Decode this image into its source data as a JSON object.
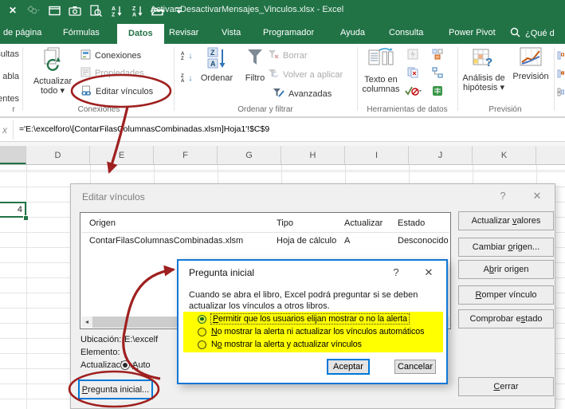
{
  "colors": {
    "excel_green": "#217346",
    "highlight_yellow": "#ffff00",
    "annotation_red": "#9f2020",
    "accent_blue": "#0078d7"
  },
  "titlebar": {
    "title": "Activar-DesactivarMensajes_Vinculos.xlsx - Excel",
    "qat_icons": [
      "close-icon",
      "shapes-icon",
      "new-window-icon",
      "camera-icon",
      "print-preview-icon",
      "sort-asc-icon",
      "sort-desc-icon",
      "open-folder-icon",
      "customize-qat-icon"
    ]
  },
  "tabs": {
    "items": [
      {
        "label": "de página"
      },
      {
        "label": "Fórmulas"
      },
      {
        "label": "Datos"
      },
      {
        "label": "Revisar"
      },
      {
        "label": "Vista"
      },
      {
        "label": "Programador"
      },
      {
        "label": "Ayuda"
      },
      {
        "label": "Consulta"
      },
      {
        "label": "Power Pivot"
      }
    ],
    "active": "Datos",
    "search_hint": "¿Qué d"
  },
  "ribbon": {
    "clipped_left": [
      "sultas",
      "abla",
      "entes"
    ],
    "clipped_group_label": "r",
    "refresh_all": {
      "line1": "Actualizar",
      "line2": "todo ▾"
    },
    "connections_group": {
      "conexiones": "Conexiones",
      "propiedades": "Propiedades",
      "editar_vinculos": "Editar vínculos",
      "label": "Conexiones"
    },
    "sort_group": {
      "ordenar": "Ordenar",
      "filtro": "Filtro",
      "borrar": "Borrar",
      "volver": "Volver a aplicar",
      "avanzadas": "Avanzadas",
      "label": "Ordenar y filtrar"
    },
    "tools_group": {
      "line1": "Texto en",
      "line2": "columnas",
      "label": "Herramientas de datos"
    },
    "forecast_group": {
      "whatif1": "Análisis de",
      "whatif2": "hipótesis ▾",
      "prevision": "Previsión",
      "label": "Previsión"
    }
  },
  "formula_bar": {
    "fx_fragment": "x",
    "formula": "='E:\\excelforo\\[ContarFilasColumnasCombinadas.xlsm]Hoja1'!$C$9"
  },
  "sheet": {
    "columns": [
      "D",
      "E",
      "F",
      "G",
      "H",
      "I",
      "J",
      "K"
    ],
    "selected_cell_value": "4"
  },
  "edit_links": {
    "title": "Editar vínculos",
    "help": "?",
    "close": "✕",
    "table": {
      "headers": {
        "origen": "Origen",
        "tipo": "Tipo",
        "actualizar": "Actualizar",
        "estado": "Estado"
      },
      "row": {
        "origen": "ContarFilasColumnasCombinadas.xlsm",
        "tipo": "Hoja de cálculo",
        "actualizar": "A",
        "estado": "Desconocido"
      }
    },
    "buttons": {
      "update_values": {
        "pre": "Actualizar ",
        "key": "v",
        "post": "alores"
      },
      "change_source": {
        "pre": "Cambiar ",
        "key": "o",
        "post": "rigen..."
      },
      "open_source": {
        "pre": "A",
        "key": "b",
        "post": "rir origen"
      },
      "break_link": {
        "pre": "",
        "key": "R",
        "post": "omper vínculo"
      },
      "check_status": {
        "pre": "Comprobar e",
        "key": "s",
        "post": "tado"
      },
      "close": {
        "pre": "",
        "key": "C",
        "post": "errar"
      },
      "startup_prompt": {
        "pre": "",
        "key": "P",
        "post": "regunta inicial..."
      }
    },
    "fields": {
      "location_label": "Ubicación:",
      "location_value": "E:\\excelf",
      "item_label": "Elemento:",
      "update_label": "Actualización:",
      "update_value": {
        "pre": "",
        "key": "A",
        "post": "uto"
      }
    },
    "scroll_left_arrow": "◄"
  },
  "startup_prompt": {
    "title": "Pregunta inicial",
    "help": "?",
    "close": "✕",
    "body_line1": "Cuando se abra el libro, Excel podrá preguntar si se deben",
    "body_line2": "actualizar los vínculos a otros libros.",
    "options": [
      {
        "pre": "",
        "key": "P",
        "post": "ermitir que los usuarios elijan mostrar o no la alerta",
        "selected": true
      },
      {
        "pre": "",
        "key": "N",
        "post": "o mostrar la alerta ni actualizar los vínculos automáticos",
        "selected": false
      },
      {
        "pre": "N",
        "key": "o",
        "post": " mostrar la alerta y actualizar vínculos",
        "selected": false
      }
    ],
    "ok": "Aceptar",
    "cancel": "Cancelar"
  }
}
